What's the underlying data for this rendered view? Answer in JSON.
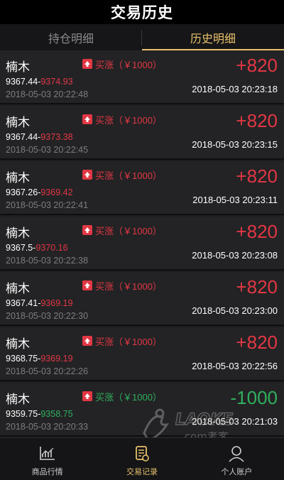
{
  "header": {
    "title": "交易历史"
  },
  "tabs": [
    {
      "label": "持仓明细",
      "active": false
    },
    {
      "label": "历史明细",
      "active": true
    }
  ],
  "records": [
    {
      "name": "楠木",
      "direction": "买涨（￥1000）",
      "open_price": "9367.44",
      "close_price": "9374.93",
      "open_time": "2018-05-03 20:22:48",
      "profit": "+820",
      "close_time": "2018-05-03 20:23:18",
      "gain": true
    },
    {
      "name": "楠木",
      "direction": "买涨（￥1000）",
      "open_price": "9367.44",
      "close_price": "9373.38",
      "open_time": "2018-05-03 20:22:45",
      "profit": "+820",
      "close_time": "2018-05-03 20:23:15",
      "gain": true
    },
    {
      "name": "楠木",
      "direction": "买涨（￥1000）",
      "open_price": "9367.26",
      "close_price": "9369.42",
      "open_time": "2018-05-03 20:22:41",
      "profit": "+820",
      "close_time": "2018-05-03 20:23:11",
      "gain": true
    },
    {
      "name": "楠木",
      "direction": "买涨（￥1000）",
      "open_price": "9367.5",
      "close_price": "9370.16",
      "open_time": "2018-05-03 20:22:38",
      "profit": "+820",
      "close_time": "2018-05-03 20:23:08",
      "gain": true
    },
    {
      "name": "楠木",
      "direction": "买涨（￥1000）",
      "open_price": "9367.41",
      "close_price": "9369.19",
      "open_time": "2018-05-03 20:22:30",
      "profit": "+820",
      "close_time": "2018-05-03 20:23:00",
      "gain": true
    },
    {
      "name": "楠木",
      "direction": "买涨（￥1000）",
      "open_price": "9368.75",
      "close_price": "9369.19",
      "open_time": "2018-05-03 20:22:26",
      "profit": "+820",
      "close_time": "2018-05-03 20:22:56",
      "gain": true
    },
    {
      "name": "楠木",
      "direction": "买涨（￥1000）",
      "open_price": "9359.75",
      "close_price": "9358.75",
      "open_time": "2018-05-03 20:20:33",
      "profit": "-1000",
      "close_time": "2018-05-03 20:21:03",
      "gain": false
    }
  ],
  "watermark": {
    "brand": "LAOKE",
    "domain": ".com考客"
  },
  "bottom_nav": [
    {
      "label": "商品行情",
      "icon": "chart-icon",
      "active": false
    },
    {
      "label": "交易记录",
      "icon": "record-icon",
      "active": true
    },
    {
      "label": "个人账户",
      "icon": "user-icon",
      "active": false
    }
  ],
  "colors": {
    "up": "#e23744",
    "down": "#2fb05d",
    "accent": "#e8c06a"
  }
}
